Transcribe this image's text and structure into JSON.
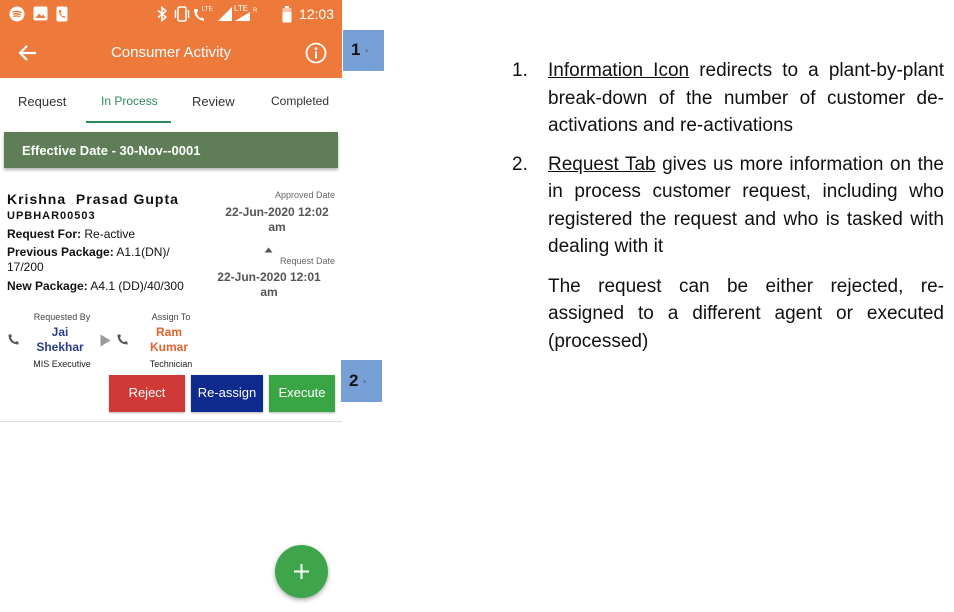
{
  "status_bar": {
    "time": "12:03",
    "left_icons": [
      "spotify-icon",
      "gallery-icon",
      "phone-icon"
    ],
    "right_icons": [
      "bluetooth-icon",
      "vibrate-icon",
      "lte-call-icon",
      "signal-icon",
      "lte-signal-icon",
      "battery-icon"
    ],
    "lte1": "LTE",
    "lte2": "LTE"
  },
  "app_bar": {
    "title": "Consumer Activity",
    "back_icon": "arrow-left-icon",
    "info_icon": "info-circle-icon"
  },
  "tabs": [
    {
      "label": "Request",
      "active": false
    },
    {
      "label": "In Process",
      "active": true
    },
    {
      "label": "Review",
      "active": false
    },
    {
      "label": "Completed",
      "active": false
    }
  ],
  "banner": {
    "text": "Effective Date - 30-Nov--0001"
  },
  "card": {
    "customer_name": "Krishna  Prasad Gupta",
    "customer_id": "UPBHAR00503",
    "request_for_label": "Request For:",
    "request_for_value": "Re-active",
    "previous_package_label": "Previous Package:",
    "previous_package_value": "A1.1(DN)/ 17/200",
    "new_package_label": "New Package:",
    "new_package_value": "A4.1 (DD)/40/300",
    "approved_date_caption": "Approved Date",
    "approved_date_value": "22-Jun-2020 12:02 am",
    "request_date_caption": "Request Date",
    "request_date_value": "22-Jun-2020 12:01 am",
    "requested_by_caption": "Requested By",
    "requester_name": "Jai Shekhar",
    "requester_role": "MIS Executive",
    "assign_to_caption": "Assign To",
    "assignee_name": "Ram Kumar",
    "assignee_role": "Technician",
    "buttons": {
      "reject": "Reject",
      "reassign": "Re-assign",
      "execute": "Execute"
    },
    "colors": {
      "reject": "#d03a36",
      "reassign": "#0f2a8f",
      "execute": "#3aa545"
    }
  },
  "fab": {
    "icon": "plus-icon"
  },
  "callouts": [
    {
      "number": "1",
      "mark": "₃"
    },
    {
      "number": "2",
      "mark": "₃"
    }
  ],
  "description": {
    "items": [
      {
        "number": "1.",
        "term": "Information Icon",
        "text": " redirects to a plant-by-plant break-down of the number of customer de-activations and re-activations"
      },
      {
        "number": "2.",
        "term": "Request Tab",
        "text": " gives us more information on the in process customer request, including who registered the request and who is tasked with dealing with it"
      }
    ],
    "note": "The request can be either rejected, re-assigned to a different agent or executed (processed)"
  },
  "theme": {
    "primary": "#ed7a3b",
    "accent": "#2e8b57",
    "banner": "#5f7d57",
    "callout": "#77a1d6"
  }
}
